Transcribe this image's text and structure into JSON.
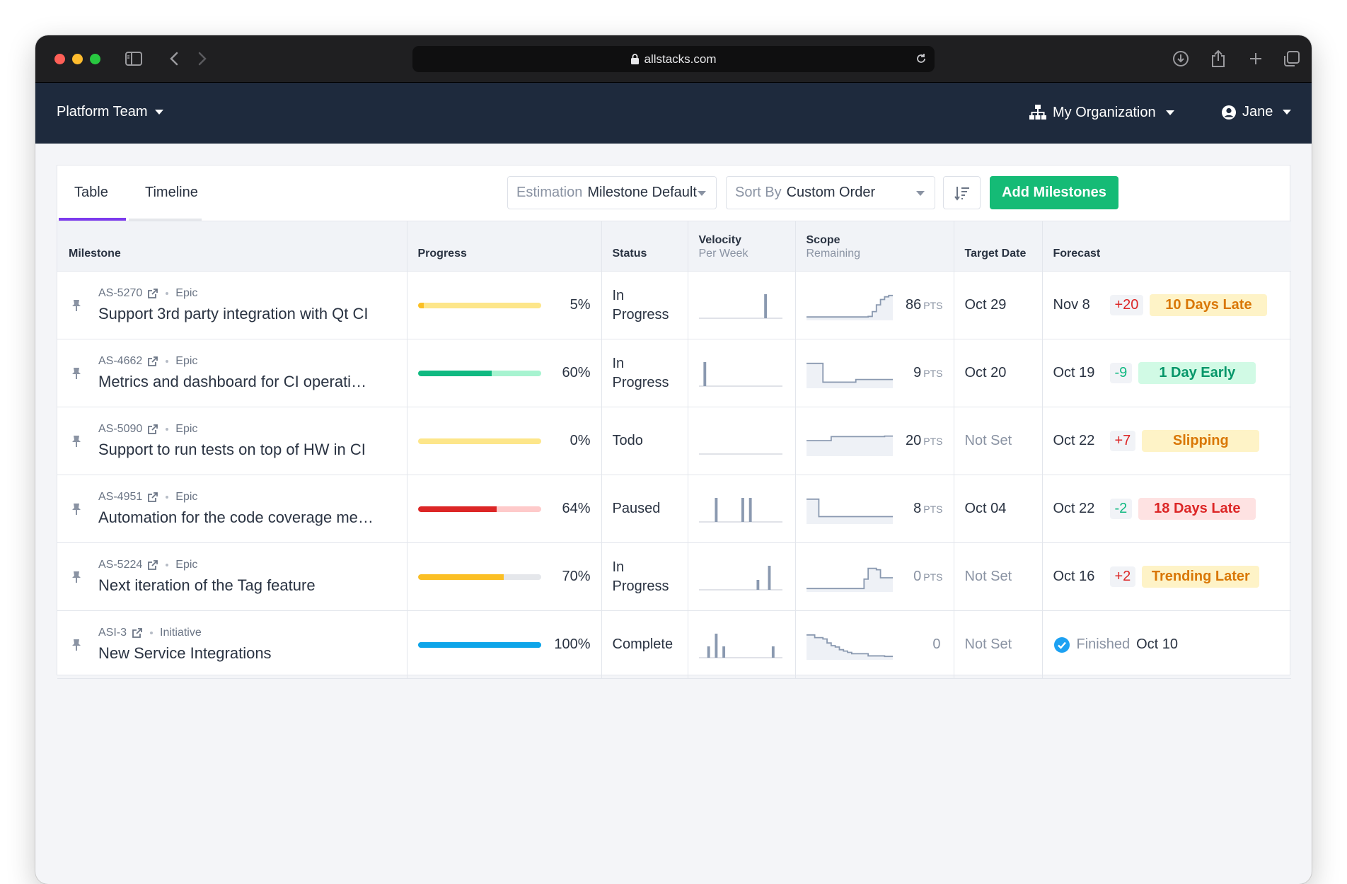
{
  "browser": {
    "url": "allstacks.com"
  },
  "nav": {
    "team": "Platform Team",
    "org": "My Organization",
    "user": "Jane"
  },
  "tabs": [
    {
      "label": "Table"
    },
    {
      "label": "Timeline"
    }
  ],
  "estimation": {
    "label": "Estimation",
    "value": "Milestone Default"
  },
  "sort": {
    "label": "Sort By",
    "value": "Custom Order"
  },
  "add_button": "Add Milestones",
  "columns": {
    "milestone": "Milestone",
    "progress": "Progress",
    "status": "Status",
    "velocity": "Velocity",
    "velocity_sub": "Per Week",
    "scope": "Scope",
    "scope_sub": "Remaining",
    "target": "Target Date",
    "forecast": "Forecast"
  },
  "rows": [
    {
      "key": "AS-5270",
      "type": "Epic",
      "title": "Support 3rd party integration with Qt CI",
      "progress_pct": "5%",
      "progress_value": 0.05,
      "bar_color": "#fbbf24",
      "bar_track": "#fde68a",
      "status": "In Progress",
      "scope": "86",
      "scope_unit": "PTS",
      "target": "Oct 29",
      "forecast": "Nov 8",
      "delta": "+20",
      "delta_color": "#dc2626",
      "badge": "10 Days Late",
      "badge_fg": "#d97706",
      "badge_bg": "#fef3c7",
      "velocity": [
        0,
        0,
        0,
        0,
        0,
        0,
        0,
        0,
        0,
        0,
        0,
        0,
        0,
        0,
        0,
        0,
        0,
        0.85,
        0,
        0,
        0,
        0
      ],
      "scope_line": [
        0.1,
        0.1,
        0.1,
        0.1,
        0.1,
        0.1,
        0.1,
        0.1,
        0.1,
        0.1,
        0.1,
        0.1,
        0.1,
        0.1,
        0.1,
        0.12,
        0.3,
        0.55,
        0.75,
        0.85,
        0.9,
        0.9
      ]
    },
    {
      "key": "AS-4662",
      "type": "Epic",
      "title": "Metrics and dashboard for CI operati…",
      "progress_pct": "60%",
      "progress_value": 0.6,
      "bar_color": "#10b981",
      "bar_track": "#a7f3d0",
      "status": "In Progress",
      "scope": "9",
      "scope_unit": "PTS",
      "target": "Oct 20",
      "forecast": "Oct 19",
      "delta": "-9",
      "delta_color": "#10b981",
      "badge": "1 Day Early",
      "badge_fg": "#059669",
      "badge_bg": "#d1fae5",
      "velocity": [
        0,
        0.85,
        0,
        0,
        0,
        0,
        0,
        0,
        0,
        0,
        0,
        0,
        0,
        0,
        0,
        0,
        0,
        0,
        0,
        0,
        0,
        0
      ],
      "scope_line": [
        0.9,
        0.9,
        0.9,
        0.9,
        0.2,
        0.2,
        0.2,
        0.2,
        0.2,
        0.2,
        0.2,
        0.2,
        0.3,
        0.3,
        0.3,
        0.3,
        0.3,
        0.3,
        0.3,
        0.3,
        0.3,
        0.3
      ]
    },
    {
      "key": "AS-5090",
      "type": "Epic",
      "title": "Support to run tests on top of HW in CI",
      "progress_pct": "0%",
      "progress_value": 0.0,
      "bar_color": "#fde68a",
      "bar_track": "#fde68a",
      "status": "Todo",
      "scope": "20",
      "scope_unit": "PTS",
      "target": "Not Set",
      "forecast": "Oct 22",
      "delta": "+7",
      "delta_color": "#dc2626",
      "badge": "Slipping",
      "badge_fg": "#d97706",
      "badge_bg": "#fef3c7",
      "velocity": [
        0,
        0,
        0,
        0,
        0,
        0,
        0,
        0,
        0,
        0,
        0,
        0,
        0,
        0,
        0,
        0,
        0,
        0,
        0,
        0,
        0,
        0
      ],
      "scope_line": [
        0.55,
        0.55,
        0.55,
        0.55,
        0.55,
        0.55,
        0.7,
        0.7,
        0.7,
        0.7,
        0.7,
        0.7,
        0.7,
        0.7,
        0.7,
        0.7,
        0.7,
        0.7,
        0.7,
        0.72,
        0.72,
        0.72
      ]
    },
    {
      "key": "AS-4951",
      "type": "Epic",
      "title": "Automation for the code coverage me…",
      "progress_pct": "64%",
      "progress_value": 0.64,
      "bar_color": "#dc2626",
      "bar_track": "#fecaca",
      "status": "Paused",
      "scope": "8",
      "scope_unit": "PTS",
      "target": "Oct 04",
      "forecast": "Oct 22",
      "delta": "-2",
      "delta_color": "#10b981",
      "badge": "18 Days Late",
      "badge_fg": "#dc2626",
      "badge_bg": "#fee2e2",
      "velocity": [
        0,
        0,
        0,
        0,
        0.85,
        0,
        0,
        0,
        0,
        0,
        0,
        0.85,
        0,
        0.85,
        0,
        0,
        0,
        0,
        0,
        0,
        0,
        0
      ],
      "scope_line": [
        0.9,
        0.9,
        0.9,
        0.25,
        0.25,
        0.25,
        0.25,
        0.25,
        0.25,
        0.25,
        0.25,
        0.25,
        0.25,
        0.25,
        0.25,
        0.25,
        0.25,
        0.25,
        0.25,
        0.25,
        0.25,
        0.25
      ]
    },
    {
      "key": "AS-5224",
      "type": "Epic",
      "title": "Next iteration of the Tag feature",
      "progress_pct": "70%",
      "progress_value": 0.7,
      "bar_color": "#fbbf24",
      "bar_track": "#e5e7eb",
      "status": "In Progress",
      "scope": "0",
      "scope_unit": "PTS",
      "target": "Not Set",
      "forecast": "Oct 16",
      "delta": "+2",
      "delta_color": "#dc2626",
      "badge": "Trending Later",
      "badge_fg": "#d97706",
      "badge_bg": "#fef3c7",
      "velocity": [
        0,
        0,
        0,
        0,
        0,
        0,
        0,
        0,
        0,
        0,
        0,
        0,
        0,
        0,
        0,
        0.35,
        0,
        0,
        0.85,
        0,
        0,
        0
      ],
      "scope_line": [
        0.1,
        0.1,
        0.1,
        0.1,
        0.1,
        0.1,
        0.1,
        0.1,
        0.1,
        0.1,
        0.1,
        0.1,
        0.1,
        0.1,
        0.45,
        0.85,
        0.85,
        0.8,
        0.5,
        0.5,
        0.5,
        0.5
      ]
    },
    {
      "key": "ASI-3",
      "type": "Initiative",
      "title": "New Service Integrations",
      "progress_pct": "100%",
      "progress_value": 1.0,
      "bar_color": "#0ea5e9",
      "bar_track": "#0ea5e9",
      "status": "Complete",
      "scope": "0",
      "scope_unit": "",
      "target": "Not Set",
      "finished_label": "Finished",
      "finished_date": "Oct 10",
      "velocity": [
        0,
        0,
        0.4,
        0,
        0.85,
        0,
        0.4,
        0,
        0,
        0,
        0,
        0,
        0,
        0,
        0,
        0,
        0,
        0,
        0,
        0.4,
        0,
        0
      ],
      "scope_line": [
        0.9,
        0.9,
        0.8,
        0.8,
        0.75,
        0.6,
        0.5,
        0.45,
        0.35,
        0.3,
        0.25,
        0.2,
        0.2,
        0.2,
        0.2,
        0.12,
        0.12,
        0.12,
        0.12,
        0.1,
        0.1,
        0.1
      ]
    }
  ],
  "colors": {
    "accent": "#15bb76",
    "tab_active": "#7c3aed",
    "nav_bg": "#1e2a3d"
  }
}
